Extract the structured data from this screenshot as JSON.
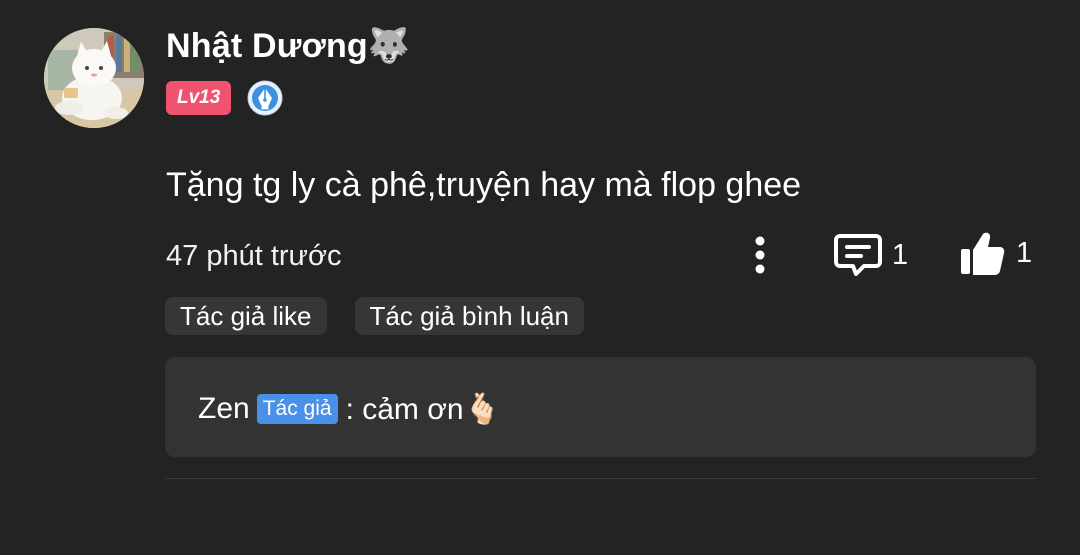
{
  "comment": {
    "author": {
      "name": "Nhật Dương🐺",
      "level": "Lv13",
      "avatar_icon": "cat-avatar-illustration",
      "badge_icon": "pen-nib-badge-icon"
    },
    "text": "Tặng tg ly cà phê,truyện hay mà flop ghee",
    "time": "47 phút trước",
    "actions": {
      "more_icon": "more-vertical-icon",
      "reply_icon": "comment-icon",
      "reply_count": "1",
      "like_icon": "thumbs-up-icon",
      "like_count": "1"
    },
    "tags": [
      "Tác giả like",
      "Tác giả bình luận"
    ],
    "reply": {
      "name": "Zen",
      "role": "Tác giả",
      "text": ": cảm ơn🫰🏻"
    }
  },
  "colors": {
    "background": "#232323",
    "level_badge": "#f0536f",
    "author_tag": "#4a8fe8",
    "chip_bg": "#363636",
    "reply_bg": "#333333"
  }
}
